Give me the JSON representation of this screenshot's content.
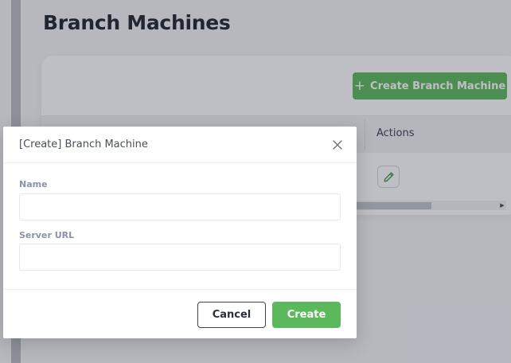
{
  "page": {
    "title": "Branch Machines",
    "create_button_label": "Create Branch Machine",
    "create_button_icon": "plus-icon",
    "table": {
      "columns": [
        "Actions"
      ],
      "rows": [
        {
          "actions": [
            "edit-pencil-icon"
          ]
        }
      ]
    }
  },
  "modal": {
    "title": "[Create] Branch Machine",
    "close_icon": "close-icon",
    "fields": {
      "name": {
        "label": "Name",
        "value": "",
        "placeholder": ""
      },
      "server_url": {
        "label": "Server URL",
        "value": "",
        "placeholder": ""
      }
    },
    "cancel_label": "Cancel",
    "submit_label": "Create"
  },
  "colors": {
    "primary_green": "#5cb85c",
    "overlay": "rgba(40,42,60,0.30)",
    "label_muted": "#8d91a8"
  }
}
